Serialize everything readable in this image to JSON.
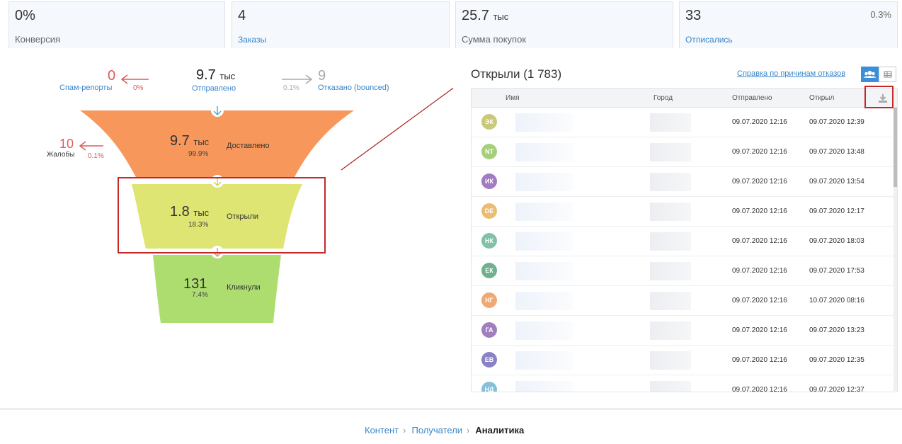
{
  "stats": [
    {
      "value": "0%",
      "unit": "",
      "label": "Конверсия",
      "label_link": false,
      "corner": ""
    },
    {
      "value": "4",
      "unit": "",
      "label": "Заказы",
      "label_link": true,
      "corner": ""
    },
    {
      "value": "25.7",
      "unit": "тыс",
      "label": "Сумма покупок",
      "label_link": false,
      "corner": ""
    },
    {
      "value": "33",
      "unit": "",
      "label": "Отписались",
      "label_link": true,
      "corner": "0.3%"
    }
  ],
  "funnel": {
    "spam": {
      "value": "0",
      "label": "Спам-репорты",
      "pct": "0%"
    },
    "sent": {
      "value": "9.7",
      "unit": "тыс",
      "label": "Отправлено"
    },
    "bounced": {
      "value": "9",
      "label": "Отказано (bounced)",
      "pct": "0.1%"
    },
    "complaints": {
      "value": "10",
      "label": "Жалобы",
      "pct": "0.1%"
    },
    "delivered": {
      "value": "9.7",
      "unit": "тыс",
      "pct": "99.9%",
      "label": "Доставлено"
    },
    "opened": {
      "value": "1.8",
      "unit": "тыс",
      "pct": "18.3%",
      "label": "Открыли"
    },
    "clicked": {
      "value": "131",
      "unit": "",
      "pct": "7.4%",
      "label": "Кликнули"
    }
  },
  "panel": {
    "title": "Открыли (1 783)",
    "help_link": "Справка по причинам отказов",
    "columns": {
      "name": "Имя",
      "city": "Город",
      "sent": "Отправлено",
      "opened": "Открыл"
    },
    "rows": [
      {
        "initials": "ЭК",
        "color": "#c9c97a",
        "sent": "09.07.2020 12:16",
        "opened": "09.07.2020 12:39"
      },
      {
        "initials": "NT",
        "color": "#a6cf7c",
        "sent": "09.07.2020 12:16",
        "opened": "09.07.2020 13:48"
      },
      {
        "initials": "ИК",
        "color": "#a27bc2",
        "sent": "09.07.2020 12:16",
        "opened": "09.07.2020 13:54"
      },
      {
        "initials": "DE",
        "color": "#ebbc76",
        "sent": "09.07.2020 12:16",
        "opened": "09.07.2020 12:17"
      },
      {
        "initials": "НК",
        "color": "#7fc2a8",
        "sent": "09.07.2020 12:16",
        "opened": "09.07.2020 18:03"
      },
      {
        "initials": "ЕК",
        "color": "#6fb08e",
        "sent": "09.07.2020 12:16",
        "opened": "09.07.2020 17:53"
      },
      {
        "initials": "НГ",
        "color": "#f1a974",
        "sent": "09.07.2020 12:16",
        "opened": "10.07.2020 08:16"
      },
      {
        "initials": "ГА",
        "color": "#a17fbf",
        "sent": "09.07.2020 12:16",
        "opened": "09.07.2020 13:23"
      },
      {
        "initials": "ЕВ",
        "color": "#8a82c3",
        "sent": "09.07.2020 12:16",
        "opened": "09.07.2020 12:35"
      },
      {
        "initials": "НД",
        "color": "#86c0d8",
        "sent": "09.07.2020 12:16",
        "opened": "09.07.2020 12:37"
      }
    ]
  },
  "breadcrumb": {
    "items": [
      "Контент",
      "Получатели"
    ],
    "current": "Аналитика"
  },
  "colors": {
    "delivered": "#f7975b",
    "opened": "#dee572",
    "clicked": "#addd6f",
    "highlight": "#c62828",
    "accent": "#3a86c8"
  }
}
